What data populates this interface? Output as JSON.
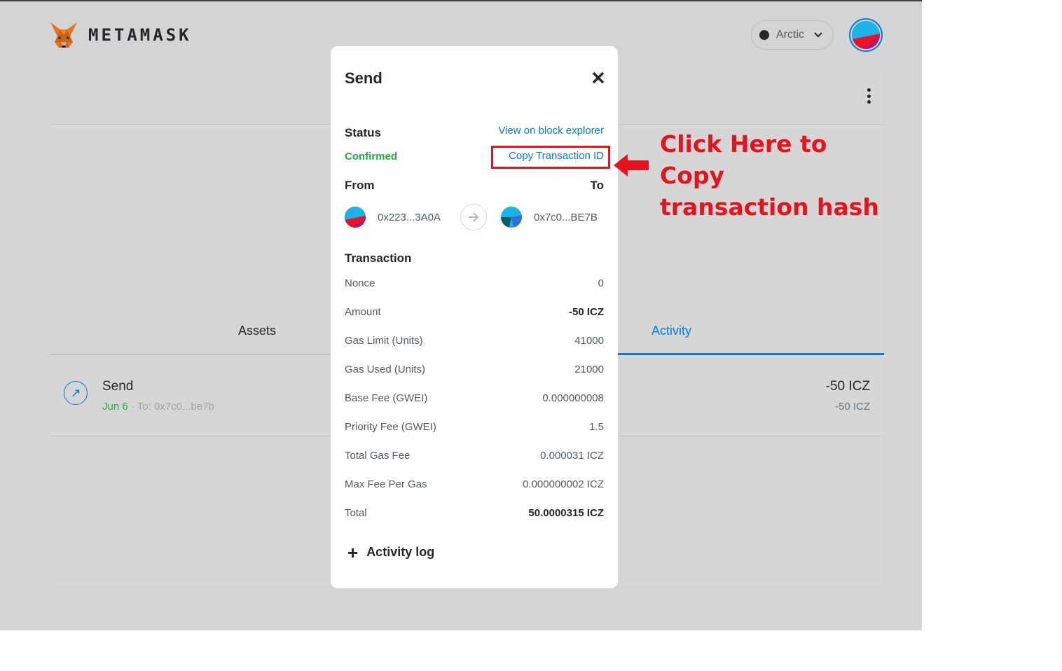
{
  "app": {
    "brand": "METAMASK",
    "logo_icon": "metamask-fox-icon"
  },
  "network": {
    "name": "Arctic"
  },
  "account": {
    "avatar_icon": "account-avatar-icon"
  },
  "tabs": {
    "assets": "Assets",
    "activity": "Activity"
  },
  "activity_row": {
    "title": "Send",
    "date": "Jun 6",
    "separator": " · ",
    "to": "To: 0x7c0...be7b",
    "amount": "-50 ICZ",
    "amount_secondary": "-50 ICZ"
  },
  "modal": {
    "title": "Send",
    "status_label": "Status",
    "status_value": "Confirmed",
    "view_explorer": "View on block explorer",
    "copy_txid": "Copy Transaction ID",
    "from_label": "From",
    "to_label": "To",
    "from_address": "0x223...3A0A",
    "to_address": "0x7c0...BE7B",
    "transaction_label": "Transaction",
    "rows": [
      {
        "label": "Nonce",
        "value": "0"
      },
      {
        "label": "Amount",
        "value": "-50 ICZ"
      },
      {
        "label": "Gas Limit (Units)",
        "value": "41000"
      },
      {
        "label": "Gas Used (Units)",
        "value": "21000"
      },
      {
        "label": "Base Fee (GWEI)",
        "value": "0.000000008"
      },
      {
        "label": "Priority Fee (GWEI)",
        "value": "1.5"
      },
      {
        "label": "Total Gas Fee",
        "value": "0.000031 ICZ"
      },
      {
        "label": "Max Fee Per Gas",
        "value": "0.000000002 ICZ"
      },
      {
        "label": "Total",
        "value": "50.0000315 ICZ"
      }
    ],
    "activity_log": "Activity log"
  },
  "annotation": {
    "text_line1": "Click Here to Copy",
    "text_line2": "transaction hash",
    "color": "#e3141f"
  },
  "colors": {
    "link": "#037dd6",
    "success": "#28a745",
    "overlay": "#d3d4d6"
  }
}
